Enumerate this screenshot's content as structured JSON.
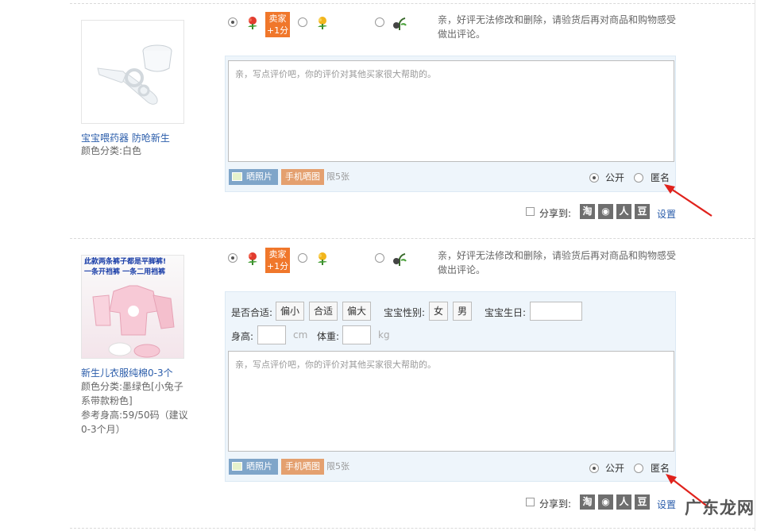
{
  "rating": {
    "seller_badge": [
      "卖家",
      "+1分"
    ]
  },
  "hint": "亲，好评无法修改和删除，请验货后再对商品和购物感受做出评论。",
  "placeholder": "亲，写点评价吧，你的评价对其他买家很大帮助的。",
  "photo_button": "晒照片",
  "mobile_button": "手机晒图",
  "photo_limit": "限5张",
  "visibility": {
    "public": "公开",
    "anonymous": "匿名"
  },
  "share": {
    "label": "分享到:",
    "icons": [
      "淘",
      "◉",
      "人",
      "豆"
    ],
    "settings": "设置"
  },
  "items": [
    {
      "name": "宝宝喂药器 防呛新生",
      "meta": [
        "颜色分类:白色"
      ]
    },
    {
      "name": "新生儿衣服纯棉0-3个",
      "meta": [
        "颜色分类:墨绿色[小兔子系带款粉色]",
        "参考身高:59/50码（建议0-3个月）"
      ],
      "image_caption": [
        "此款两条裤子都是平脚裤!",
        "一条开裆裤  一条二用裆裤"
      ]
    }
  ],
  "extra": {
    "fit_label": "是否合适:",
    "fit_options": [
      "偏小",
      "合适",
      "偏大"
    ],
    "gender_label": "宝宝性别:",
    "gender_options": [
      "女",
      "男"
    ],
    "birthday_label": "宝宝生日:",
    "height_label": "身高:",
    "height_unit": "cm",
    "weight_label": "体重:",
    "weight_unit": "kg"
  },
  "watermark": "广东龙网",
  "colors": {
    "link": "#2a5caa",
    "badge": "#f0772b",
    "box_bg": "#eef5fb",
    "arrow": "#e0221c"
  }
}
